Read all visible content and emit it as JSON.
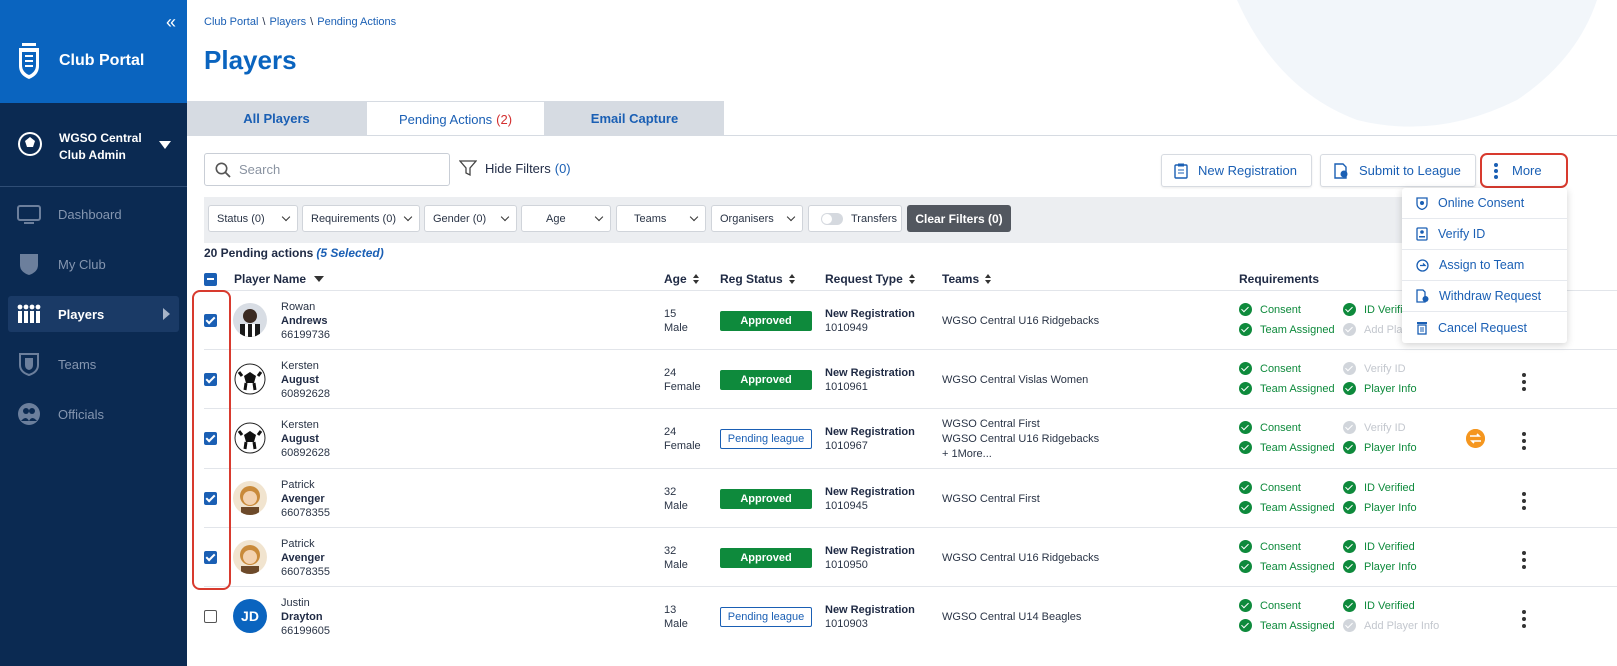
{
  "sidebar": {
    "collapse_icon": "«",
    "app_title": "Club Portal",
    "club_name": "WGSO Central",
    "club_role": "Club Admin",
    "nav": [
      {
        "label": "Dashboard",
        "icon": "dashboard-icon"
      },
      {
        "label": "My Club",
        "icon": "shield-icon"
      },
      {
        "label": "Players",
        "icon": "players-icon",
        "active": true
      },
      {
        "label": "Teams",
        "icon": "teams-shield-icon"
      },
      {
        "label": "Officials",
        "icon": "officials-icon"
      }
    ]
  },
  "breadcrumb": [
    "Club Portal",
    "Players",
    "Pending Actions"
  ],
  "breadcrumb_sep": "\\",
  "page_title": "Players",
  "tabs": [
    {
      "label": "All Players",
      "count": ""
    },
    {
      "label": "Pending Actions",
      "count": "(2)"
    },
    {
      "label": "Email Capture",
      "count": ""
    }
  ],
  "search": {
    "placeholder": "Search"
  },
  "hide_filters": {
    "label": "Hide Filters",
    "count": "(0)"
  },
  "actions": {
    "new_registration": "New Registration",
    "submit_league": "Submit to League",
    "more": "More"
  },
  "more_menu": [
    "Online Consent",
    "Verify ID",
    "Assign to Team",
    "Withdraw Request",
    "Cancel Request"
  ],
  "filters": {
    "status": "Status (0)",
    "requirements": "Requirements (0)",
    "gender": "Gender (0)",
    "age": "Age",
    "teams": "Teams",
    "organisers": "Organisers",
    "transfers": "Transfers",
    "clear": "Clear Filters (0)"
  },
  "summary": {
    "count_text": "20 Pending actions",
    "selected_text": "(5 Selected)"
  },
  "columns": {
    "player_name": "Player Name",
    "age": "Age",
    "reg_status": "Reg Status",
    "request_type": "Request Type",
    "teams": "Teams",
    "requirements": "Requirements"
  },
  "rows": [
    {
      "first": "Rowan",
      "last": "Andrews",
      "id": "66199736",
      "age": "15",
      "gender": "Male",
      "status": "Approved",
      "req_type": "New Registration",
      "req_id": "1010949",
      "teams": [
        "WGSO Central U16 Ridgebacks"
      ],
      "r1": "Consent",
      "r2": "ID Verified",
      "r3": "Team Assigned",
      "r4": "Add Player Info",
      "checked": true
    },
    {
      "first": "Kersten",
      "last": "August",
      "id": "60892628",
      "age": "24",
      "gender": "Female",
      "status": "Approved",
      "req_type": "New Registration",
      "req_id": "1010961",
      "teams": [
        "WGSO Central Vislas Women"
      ],
      "r1": "Consent",
      "r2": "Verify ID",
      "r3": "Team Assigned",
      "r4": "Player Info",
      "checked": true
    },
    {
      "first": "Kersten",
      "last": "August",
      "id": "60892628",
      "age": "24",
      "gender": "Female",
      "status": "Pending league",
      "req_type": "New Registration",
      "req_id": "1010967",
      "teams": [
        "WGSO Central First",
        "WGSO Central U16 Ridgebacks",
        "+ 1More..."
      ],
      "r1": "Consent",
      "r2": "Verify ID",
      "r3": "Team Assigned",
      "r4": "Player Info",
      "checked": true
    },
    {
      "first": "Patrick",
      "last": "Avenger",
      "id": "66078355",
      "age": "32",
      "gender": "Male",
      "status": "Approved",
      "req_type": "New Registration",
      "req_id": "1010945",
      "teams": [
        "WGSO Central First"
      ],
      "r1": "Consent",
      "r2": "ID Verified",
      "r3": "Team Assigned",
      "r4": "Player Info",
      "checked": true
    },
    {
      "first": "Patrick",
      "last": "Avenger",
      "id": "66078355",
      "age": "32",
      "gender": "Male",
      "status": "Approved",
      "req_type": "New Registration",
      "req_id": "1010950",
      "teams": [
        "WGSO Central U16 Ridgebacks"
      ],
      "r1": "Consent",
      "r2": "ID Verified",
      "r3": "Team Assigned",
      "r4": "Player Info",
      "checked": true
    },
    {
      "first": "Justin",
      "last": "Drayton",
      "id": "66199605",
      "age": "13",
      "gender": "Male",
      "status": "Pending league",
      "req_type": "New Registration",
      "req_id": "1010903",
      "teams": [
        "WGSO Central U14 Beagles"
      ],
      "r1": "Consent",
      "r2": "ID Verified",
      "r3": "Team Assigned",
      "r4": "Add Player Info",
      "checked": false,
      "initials": "JD"
    }
  ],
  "colors": {
    "brand": "#0a64bf",
    "sidebar": "#0b2a52",
    "approved": "#0e8a3c",
    "highlight": "#d83a2e"
  }
}
